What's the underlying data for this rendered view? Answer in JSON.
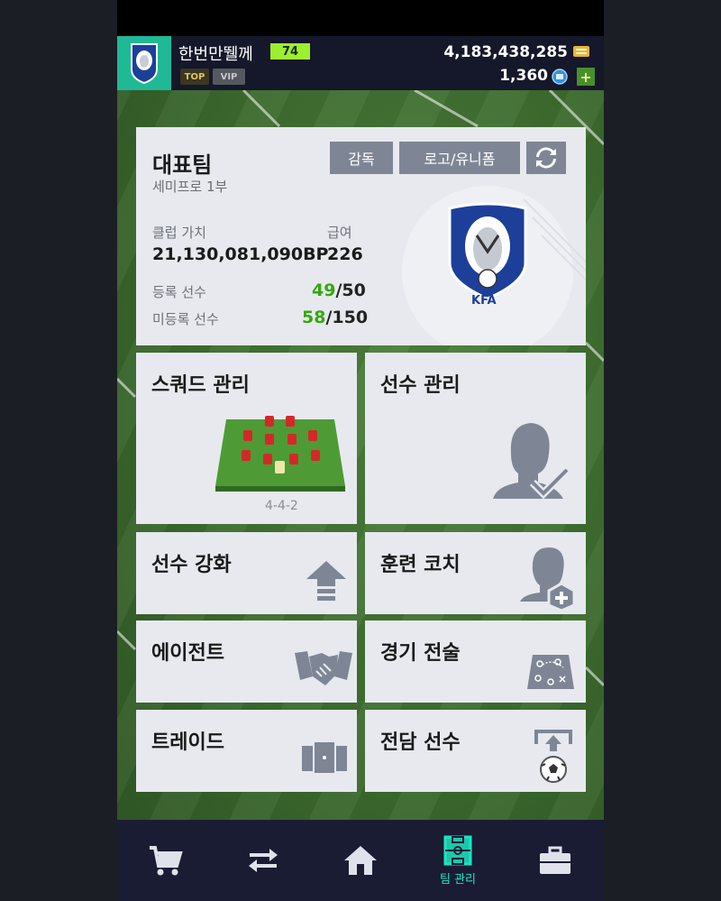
{
  "header": {
    "username": "한번만뛜께",
    "level": "74",
    "badge_top": "TOP",
    "badge_vip": "VIP",
    "coins": "4,183,438,285",
    "points": "1,360",
    "plus": "+",
    "crest_text": "KFA"
  },
  "team": {
    "name": "대표팀",
    "division": "세미프로 1부",
    "buttons": {
      "coach": "감독",
      "logo_uniform": "로고/유니폼"
    },
    "club_value_label": "클럽 가치",
    "club_value": "21,130,081,090BP",
    "salary_label": "급여",
    "salary": "226",
    "registered_label": "등록 선수",
    "registered_count": "49",
    "registered_max": "/50",
    "unregistered_label": "미등록 선수",
    "unregistered_count": "58",
    "unregistered_max": "/150",
    "crest_text": "KFA"
  },
  "tiles": {
    "squad": {
      "title": "스쿼드 관리",
      "formation": "4-4-2"
    },
    "players": {
      "title": "선수 관리"
    },
    "upgrade": {
      "title": "선수 강화"
    },
    "training": {
      "title": "훈련 코치"
    },
    "agent": {
      "title": "에이전트"
    },
    "tactics": {
      "title": "경기 전술"
    },
    "trade": {
      "title": "트레이드"
    },
    "dedicated": {
      "title": "전담 선수"
    }
  },
  "nav": {
    "items": [
      {
        "icon": "cart-icon"
      },
      {
        "icon": "transfer-icon"
      },
      {
        "icon": "home-icon"
      },
      {
        "icon": "pitch-icon",
        "label": "팀 관리",
        "active": true
      },
      {
        "icon": "bag-icon"
      }
    ]
  },
  "colors": {
    "accent": "#1fe5c2",
    "card": "#e7e9ef",
    "button_grey": "#7e8696",
    "green_count": "#35a80c",
    "level": "#9cf02f"
  }
}
